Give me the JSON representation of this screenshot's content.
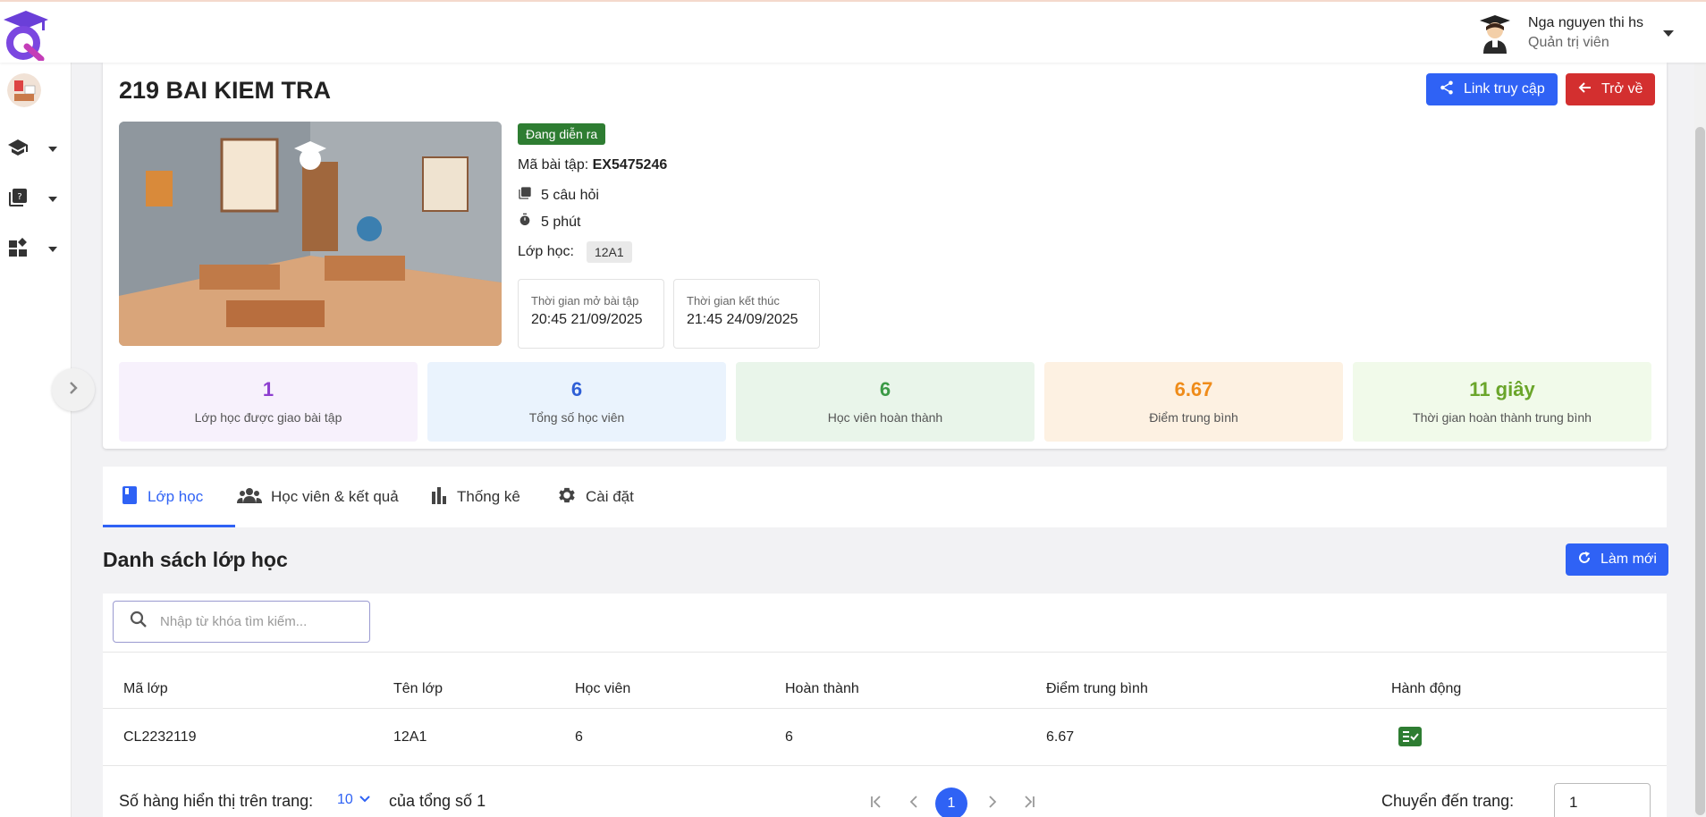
{
  "user": {
    "name": "Nga nguyen thi hs",
    "role": "Quản trị viên"
  },
  "exam": {
    "title": "219 BAI KIEM TRA",
    "status": "Đang diễn ra",
    "code_label": "Mã bài tập:",
    "code": "EX5475246",
    "questions": "5 câu hỏi",
    "duration": "5 phút",
    "class_label": "Lớp học:",
    "class_chip": "12A1",
    "open_label": "Thời gian mở bài tập",
    "open_value": "20:45 21/09/2025",
    "close_label": "Thời gian kết thúc",
    "close_value": "21:45 24/09/2025"
  },
  "actions": {
    "link": "Link truy cập",
    "back": "Trở về"
  },
  "stats": [
    {
      "value": "1",
      "label": "Lớp học được giao bài tập",
      "bg": "#f7f1fc",
      "color": "#8e3fd0"
    },
    {
      "value": "6",
      "label": "Tổng số học viên",
      "bg": "#eaf3fd",
      "color": "#2f5fd6"
    },
    {
      "value": "6",
      "label": "Học viên hoàn thành",
      "bg": "#e9f5ea",
      "color": "#3b9a46"
    },
    {
      "value": "6.67",
      "label": "Điểm trung bình",
      "bg": "#fdf1e2",
      "color": "#ef8c1a"
    },
    {
      "value": "11 giây",
      "label": "Thời gian hoàn thành trung bình",
      "bg": "#f1faea",
      "color": "#6aa52a"
    }
  ],
  "tabs": [
    {
      "label": "Lớp học"
    },
    {
      "label": "Học viên & kết quả"
    },
    {
      "label": "Thống kê"
    },
    {
      "label": "Cài đặt"
    }
  ],
  "section": {
    "title": "Danh sách lớp học",
    "refresh": "Làm mới"
  },
  "search": {
    "placeholder": "Nhập từ khóa tìm kiếm..."
  },
  "table": {
    "headers": [
      "Mã lớp",
      "Tên lớp",
      "Học viên",
      "Hoàn thành",
      "Điểm trung bình",
      "Hành động"
    ],
    "rows": [
      [
        "CL2232119",
        "12A1",
        "6",
        "6",
        "6.67"
      ]
    ]
  },
  "pagination": {
    "rows_label": "Số hàng hiển thị trên trang:",
    "rows_value": "10",
    "total_label": "của tổng số 1",
    "current": "1",
    "goto_label": "Chuyển đến trang:",
    "goto_value": "1"
  },
  "colors": {
    "primary": "#2f62f5",
    "danger": "#d32f2f",
    "success": "#2e7d32"
  }
}
